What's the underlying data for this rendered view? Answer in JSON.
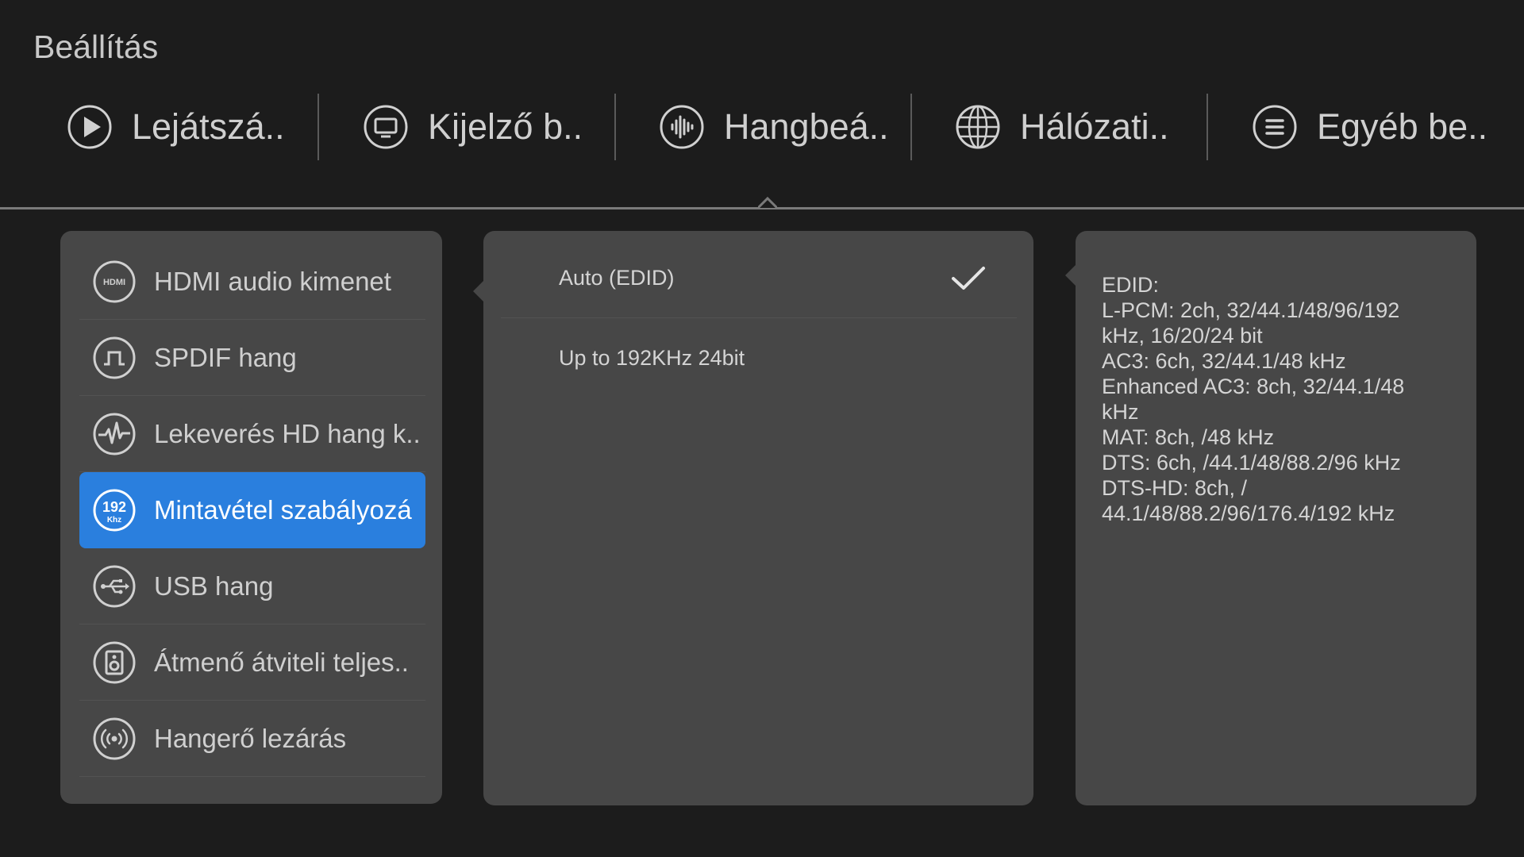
{
  "header": {
    "title": "Beállítás"
  },
  "tabs": [
    {
      "label": "Lejátszá..",
      "icon": "play-icon"
    },
    {
      "label": "Kijelző b..",
      "icon": "monitor-icon"
    },
    {
      "label": "Hangbeá..",
      "icon": "sound-wave-icon",
      "selected": true
    },
    {
      "label": "Hálózati..",
      "icon": "globe-icon"
    },
    {
      "label": "Egyéb be..",
      "icon": "menu-lines-icon"
    }
  ],
  "sidebar": {
    "items": [
      {
        "label": "HDMI audio kimenet",
        "icon": "hdmi-icon"
      },
      {
        "label": "SPDIF hang",
        "icon": "spdif-icon"
      },
      {
        "label": "Lekeverés HD hang k..",
        "icon": "waveform-icon"
      },
      {
        "label": "Mintavétel szabályozá",
        "icon": "192khz-icon",
        "active": true
      },
      {
        "label": "USB hang",
        "icon": "usb-icon"
      },
      {
        "label": "Átmenő átviteli teljes..",
        "icon": "speaker-icon"
      },
      {
        "label": "Hangerő lezárás",
        "icon": "broadcast-icon"
      }
    ]
  },
  "options": [
    {
      "label": "Auto (EDID)",
      "checked": true
    },
    {
      "label": "Up to 192KHz 24bit",
      "checked": false
    }
  ],
  "info": {
    "lines": [
      "EDID:",
      "L-PCM: 2ch, 32/44.1/48/96/192",
      "kHz, 16/20/24 bit",
      "AC3: 6ch, 32/44.1/48 kHz",
      "Enhanced AC3: 8ch, 32/44.1/48",
      "kHz",
      "MAT: 8ch, /48 kHz",
      "DTS: 6ch, /44.1/48/88.2/96 kHz",
      "DTS-HD: 8ch, /",
      "44.1/48/88.2/96/176.4/192 kHz"
    ]
  },
  "colors": {
    "background": "#1c1c1c",
    "panel": "#474747",
    "accent": "#2a7fde"
  }
}
